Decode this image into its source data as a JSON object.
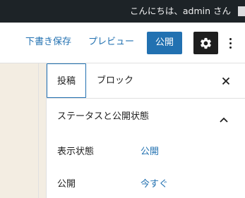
{
  "admin_bar": {
    "greeting": "こんにちは、admin さん"
  },
  "toolbar": {
    "save_draft_label": "下書き保存",
    "preview_label": "プレビュー",
    "publish_label": "公開",
    "settings_icon": "gear-icon",
    "more_icon": "more-vertical-icon"
  },
  "sidebar": {
    "tabs": [
      {
        "label": "投稿",
        "active": true
      },
      {
        "label": "ブロック",
        "active": false
      }
    ],
    "close_icon": "close-icon",
    "panel": {
      "title": "ステータスと公開状態",
      "expanded": true,
      "rows": [
        {
          "label": "表示状態",
          "value": "公開"
        },
        {
          "label": "公開",
          "value": "今すぐ"
        }
      ]
    }
  },
  "colors": {
    "admin_bar_bg": "#1d2327",
    "accent": "#2271b1",
    "canvas_bg": "#f3ede2",
    "settings_bg": "#1e1e1e"
  }
}
